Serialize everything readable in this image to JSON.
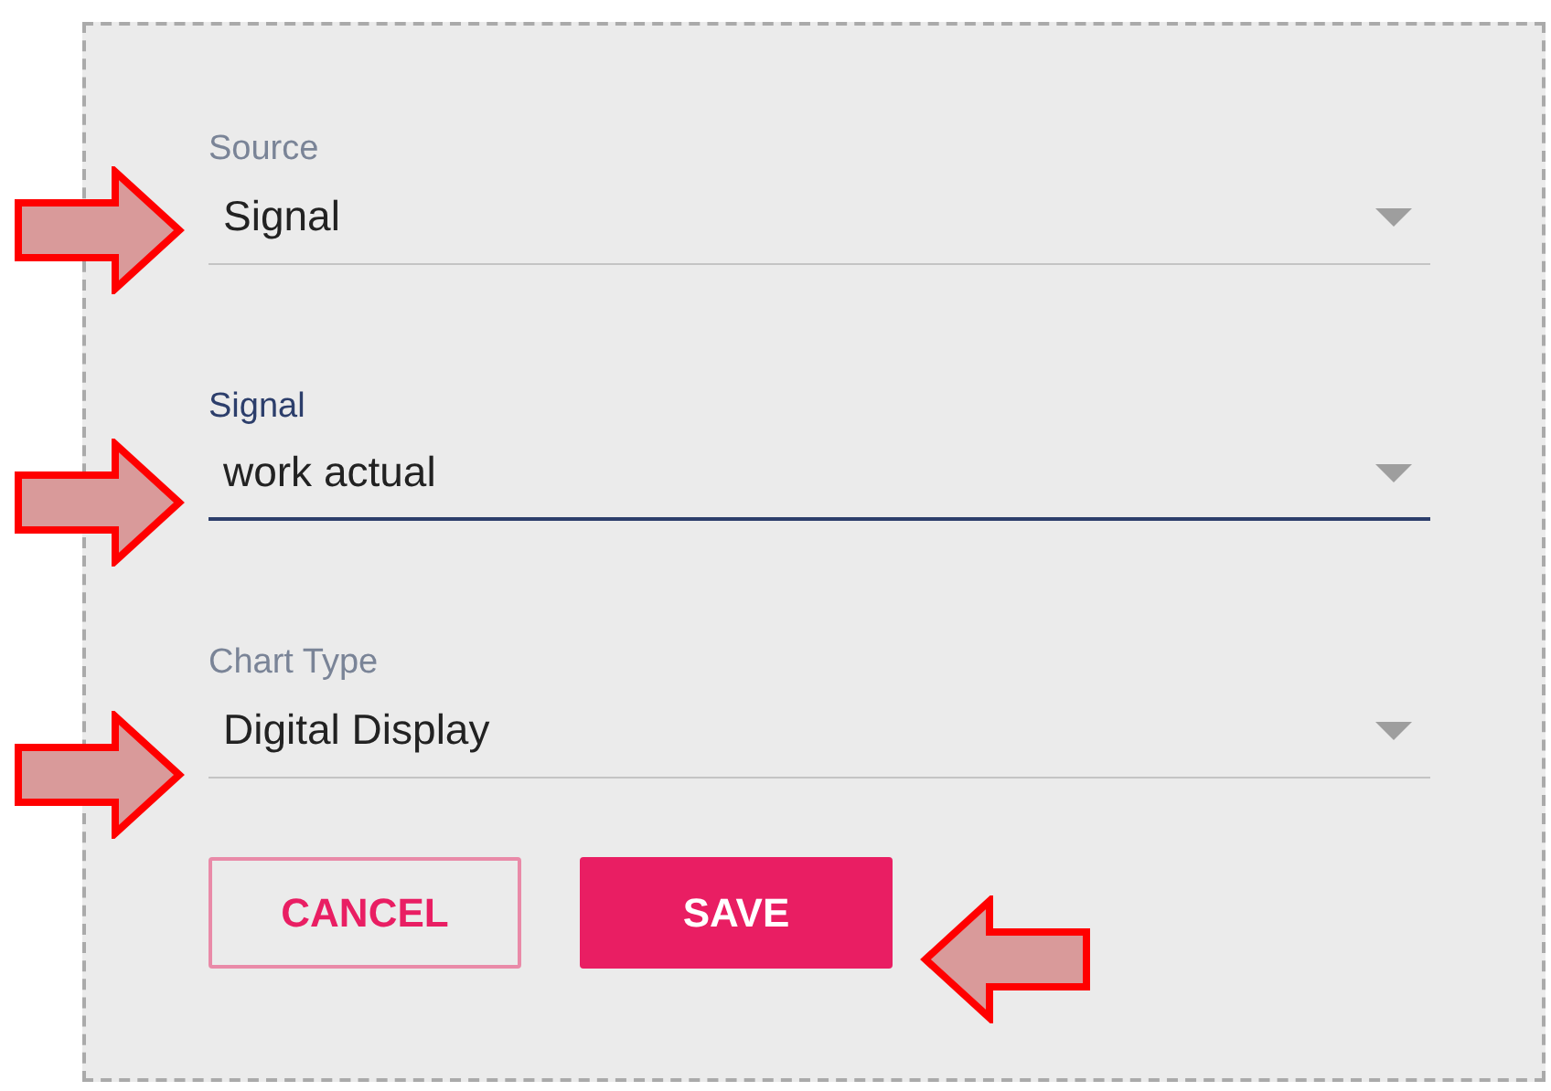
{
  "fields": [
    {
      "label": "Source",
      "value": "Signal",
      "focused": false
    },
    {
      "label": "Signal",
      "value": "work actual",
      "focused": true
    },
    {
      "label": "Chart Type",
      "value": "Digital Display",
      "focused": false
    }
  ],
  "buttons": [
    {
      "label": "CANCEL",
      "kind": "outlined"
    },
    {
      "label": "SAVE",
      "kind": "filled"
    }
  ]
}
